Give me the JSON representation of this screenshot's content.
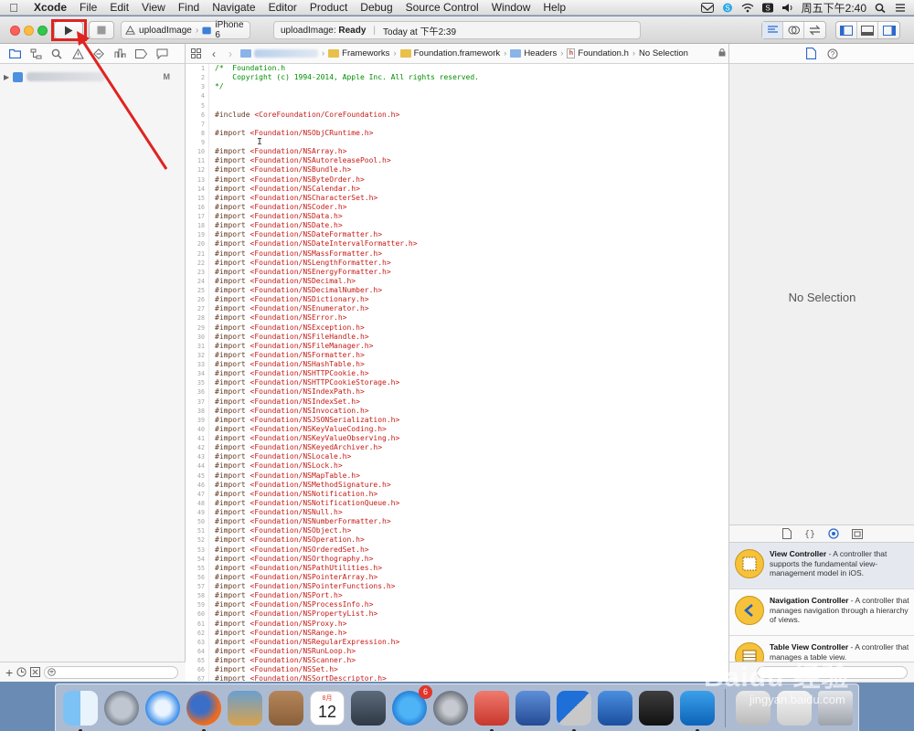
{
  "menubar": {
    "app_name": "Xcode",
    "items": [
      "File",
      "Edit",
      "View",
      "Find",
      "Navigate",
      "Editor",
      "Product",
      "Debug",
      "Source Control",
      "Window",
      "Help"
    ],
    "clock": "周五下午2:40"
  },
  "toolbar": {
    "scheme_name": "uploadImage",
    "scheme_separator": "›",
    "device": "iPhone 6",
    "activity_target": "uploadImage:",
    "activity_status": "Ready",
    "activity_sep": "|",
    "activity_time": "Today at 下午2:39",
    "run_icon": "play-icon",
    "stop_icon": "stop-icon",
    "highlight_color": "#e0231f"
  },
  "navigator": {
    "project_badge": "M"
  },
  "jumpbar": {
    "crumbs": [
      "Frameworks",
      "Foundation.framework",
      "Headers",
      "Foundation.h",
      "No Selection"
    ],
    "back": "‹",
    "forward": "›",
    "separator": "›",
    "hfile_letter": "h"
  },
  "code": {
    "lines": [
      {
        "n": "1",
        "t": "comment",
        "text": "/*  Foundation.h"
      },
      {
        "n": "2",
        "t": "comment",
        "text": "    Copyright (c) 1994-2014, Apple Inc. All rights reserved."
      },
      {
        "n": "3",
        "t": "comment",
        "text": "*/"
      },
      {
        "n": "4",
        "t": "blank",
        "text": ""
      },
      {
        "n": "5",
        "t": "blank",
        "text": ""
      },
      {
        "n": "6",
        "t": "include",
        "dir": "#include ",
        "path": "<CoreFoundation/CoreFoundation.h>"
      },
      {
        "n": "7",
        "t": "blank",
        "text": ""
      },
      {
        "n": "8",
        "t": "include",
        "dir": "#import ",
        "path": "<Foundation/NSObjCRuntime.h>"
      },
      {
        "n": "9",
        "t": "blank",
        "text": ""
      },
      {
        "n": "10",
        "t": "include",
        "dir": "#import ",
        "path": "<Foundation/NSArray.h>"
      },
      {
        "n": "11",
        "t": "include",
        "dir": "#import ",
        "path": "<Foundation/NSAutoreleasePool.h>"
      },
      {
        "n": "12",
        "t": "include",
        "dir": "#import ",
        "path": "<Foundation/NSBundle.h>"
      },
      {
        "n": "13",
        "t": "include",
        "dir": "#import ",
        "path": "<Foundation/NSByteOrder.h>"
      },
      {
        "n": "14",
        "t": "include",
        "dir": "#import ",
        "path": "<Foundation/NSCalendar.h>"
      },
      {
        "n": "15",
        "t": "include",
        "dir": "#import ",
        "path": "<Foundation/NSCharacterSet.h>"
      },
      {
        "n": "16",
        "t": "include",
        "dir": "#import ",
        "path": "<Foundation/NSCoder.h>"
      },
      {
        "n": "17",
        "t": "include",
        "dir": "#import ",
        "path": "<Foundation/NSData.h>"
      },
      {
        "n": "18",
        "t": "include",
        "dir": "#import ",
        "path": "<Foundation/NSDate.h>"
      },
      {
        "n": "19",
        "t": "include",
        "dir": "#import ",
        "path": "<Foundation/NSDateFormatter.h>"
      },
      {
        "n": "20",
        "t": "include",
        "dir": "#import ",
        "path": "<Foundation/NSDateIntervalFormatter.h>"
      },
      {
        "n": "21",
        "t": "include",
        "dir": "#import ",
        "path": "<Foundation/NSMassFormatter.h>"
      },
      {
        "n": "22",
        "t": "include",
        "dir": "#import ",
        "path": "<Foundation/NSLengthFormatter.h>"
      },
      {
        "n": "23",
        "t": "include",
        "dir": "#import ",
        "path": "<Foundation/NSEnergyFormatter.h>"
      },
      {
        "n": "24",
        "t": "include",
        "dir": "#import ",
        "path": "<Foundation/NSDecimal.h>"
      },
      {
        "n": "25",
        "t": "include",
        "dir": "#import ",
        "path": "<Foundation/NSDecimalNumber.h>"
      },
      {
        "n": "26",
        "t": "include",
        "dir": "#import ",
        "path": "<Foundation/NSDictionary.h>"
      },
      {
        "n": "27",
        "t": "include",
        "dir": "#import ",
        "path": "<Foundation/NSEnumerator.h>"
      },
      {
        "n": "28",
        "t": "include",
        "dir": "#import ",
        "path": "<Foundation/NSError.h>"
      },
      {
        "n": "29",
        "t": "include",
        "dir": "#import ",
        "path": "<Foundation/NSException.h>"
      },
      {
        "n": "30",
        "t": "include",
        "dir": "#import ",
        "path": "<Foundation/NSFileHandle.h>"
      },
      {
        "n": "31",
        "t": "include",
        "dir": "#import ",
        "path": "<Foundation/NSFileManager.h>"
      },
      {
        "n": "32",
        "t": "include",
        "dir": "#import ",
        "path": "<Foundation/NSFormatter.h>"
      },
      {
        "n": "33",
        "t": "include",
        "dir": "#import ",
        "path": "<Foundation/NSHashTable.h>"
      },
      {
        "n": "34",
        "t": "include",
        "dir": "#import ",
        "path": "<Foundation/NSHTTPCookie.h>"
      },
      {
        "n": "35",
        "t": "include",
        "dir": "#import ",
        "path": "<Foundation/NSHTTPCookieStorage.h>"
      },
      {
        "n": "36",
        "t": "include",
        "dir": "#import ",
        "path": "<Foundation/NSIndexPath.h>"
      },
      {
        "n": "37",
        "t": "include",
        "dir": "#import ",
        "path": "<Foundation/NSIndexSet.h>"
      },
      {
        "n": "38",
        "t": "include",
        "dir": "#import ",
        "path": "<Foundation/NSInvocation.h>"
      },
      {
        "n": "39",
        "t": "include",
        "dir": "#import ",
        "path": "<Foundation/NSJSONSerialization.h>"
      },
      {
        "n": "40",
        "t": "include",
        "dir": "#import ",
        "path": "<Foundation/NSKeyValueCoding.h>"
      },
      {
        "n": "41",
        "t": "include",
        "dir": "#import ",
        "path": "<Foundation/NSKeyValueObserving.h>"
      },
      {
        "n": "42",
        "t": "include",
        "dir": "#import ",
        "path": "<Foundation/NSKeyedArchiver.h>"
      },
      {
        "n": "43",
        "t": "include",
        "dir": "#import ",
        "path": "<Foundation/NSLocale.h>"
      },
      {
        "n": "44",
        "t": "include",
        "dir": "#import ",
        "path": "<Foundation/NSLock.h>"
      },
      {
        "n": "45",
        "t": "include",
        "dir": "#import ",
        "path": "<Foundation/NSMapTable.h>"
      },
      {
        "n": "46",
        "t": "include",
        "dir": "#import ",
        "path": "<Foundation/NSMethodSignature.h>"
      },
      {
        "n": "47",
        "t": "include",
        "dir": "#import ",
        "path": "<Foundation/NSNotification.h>"
      },
      {
        "n": "48",
        "t": "include",
        "dir": "#import ",
        "path": "<Foundation/NSNotificationQueue.h>"
      },
      {
        "n": "49",
        "t": "include",
        "dir": "#import ",
        "path": "<Foundation/NSNull.h>"
      },
      {
        "n": "50",
        "t": "include",
        "dir": "#import ",
        "path": "<Foundation/NSNumberFormatter.h>"
      },
      {
        "n": "51",
        "t": "include",
        "dir": "#import ",
        "path": "<Foundation/NSObject.h>"
      },
      {
        "n": "52",
        "t": "include",
        "dir": "#import ",
        "path": "<Foundation/NSOperation.h>"
      },
      {
        "n": "53",
        "t": "include",
        "dir": "#import ",
        "path": "<Foundation/NSOrderedSet.h>"
      },
      {
        "n": "54",
        "t": "include",
        "dir": "#import ",
        "path": "<Foundation/NSOrthography.h>"
      },
      {
        "n": "55",
        "t": "include",
        "dir": "#import ",
        "path": "<Foundation/NSPathUtilities.h>"
      },
      {
        "n": "56",
        "t": "include",
        "dir": "#import ",
        "path": "<Foundation/NSPointerArray.h>"
      },
      {
        "n": "57",
        "t": "include",
        "dir": "#import ",
        "path": "<Foundation/NSPointerFunctions.h>"
      },
      {
        "n": "58",
        "t": "include",
        "dir": "#import ",
        "path": "<Foundation/NSPort.h>"
      },
      {
        "n": "59",
        "t": "include",
        "dir": "#import ",
        "path": "<Foundation/NSProcessInfo.h>"
      },
      {
        "n": "60",
        "t": "include",
        "dir": "#import ",
        "path": "<Foundation/NSPropertyList.h>"
      },
      {
        "n": "61",
        "t": "include",
        "dir": "#import ",
        "path": "<Foundation/NSProxy.h>"
      },
      {
        "n": "62",
        "t": "include",
        "dir": "#import ",
        "path": "<Foundation/NSRange.h>"
      },
      {
        "n": "63",
        "t": "include",
        "dir": "#import ",
        "path": "<Foundation/NSRegularExpression.h>"
      },
      {
        "n": "64",
        "t": "include",
        "dir": "#import ",
        "path": "<Foundation/NSRunLoop.h>"
      },
      {
        "n": "65",
        "t": "include",
        "dir": "#import ",
        "path": "<Foundation/NSScanner.h>"
      },
      {
        "n": "66",
        "t": "include",
        "dir": "#import ",
        "path": "<Foundation/NSSet.h>"
      },
      {
        "n": "67",
        "t": "include",
        "dir": "#import ",
        "path": "<Foundation/NSSortDescriptor.h>"
      }
    ]
  },
  "inspector": {
    "no_selection": "No Selection"
  },
  "library": {
    "items": [
      {
        "title": "View Controller",
        "desc": " - A controller that supports the fundamental view-management model in iOS.",
        "icon": "view-controller-icon"
      },
      {
        "title": "Navigation Controller",
        "desc": " - A controller that manages navigation through a hierarchy of views.",
        "icon": "navigation-controller-icon"
      },
      {
        "title": "Table View Controller",
        "desc": " - A controller that manages a table view.",
        "icon": "table-view-controller-icon"
      }
    ]
  },
  "dock": {
    "app_store_badge": "6",
    "calendar_month": "8月",
    "calendar_day": "12"
  },
  "watermark": {
    "text": "Baidu 经验",
    "sub": "jingyan.baidu.com"
  }
}
